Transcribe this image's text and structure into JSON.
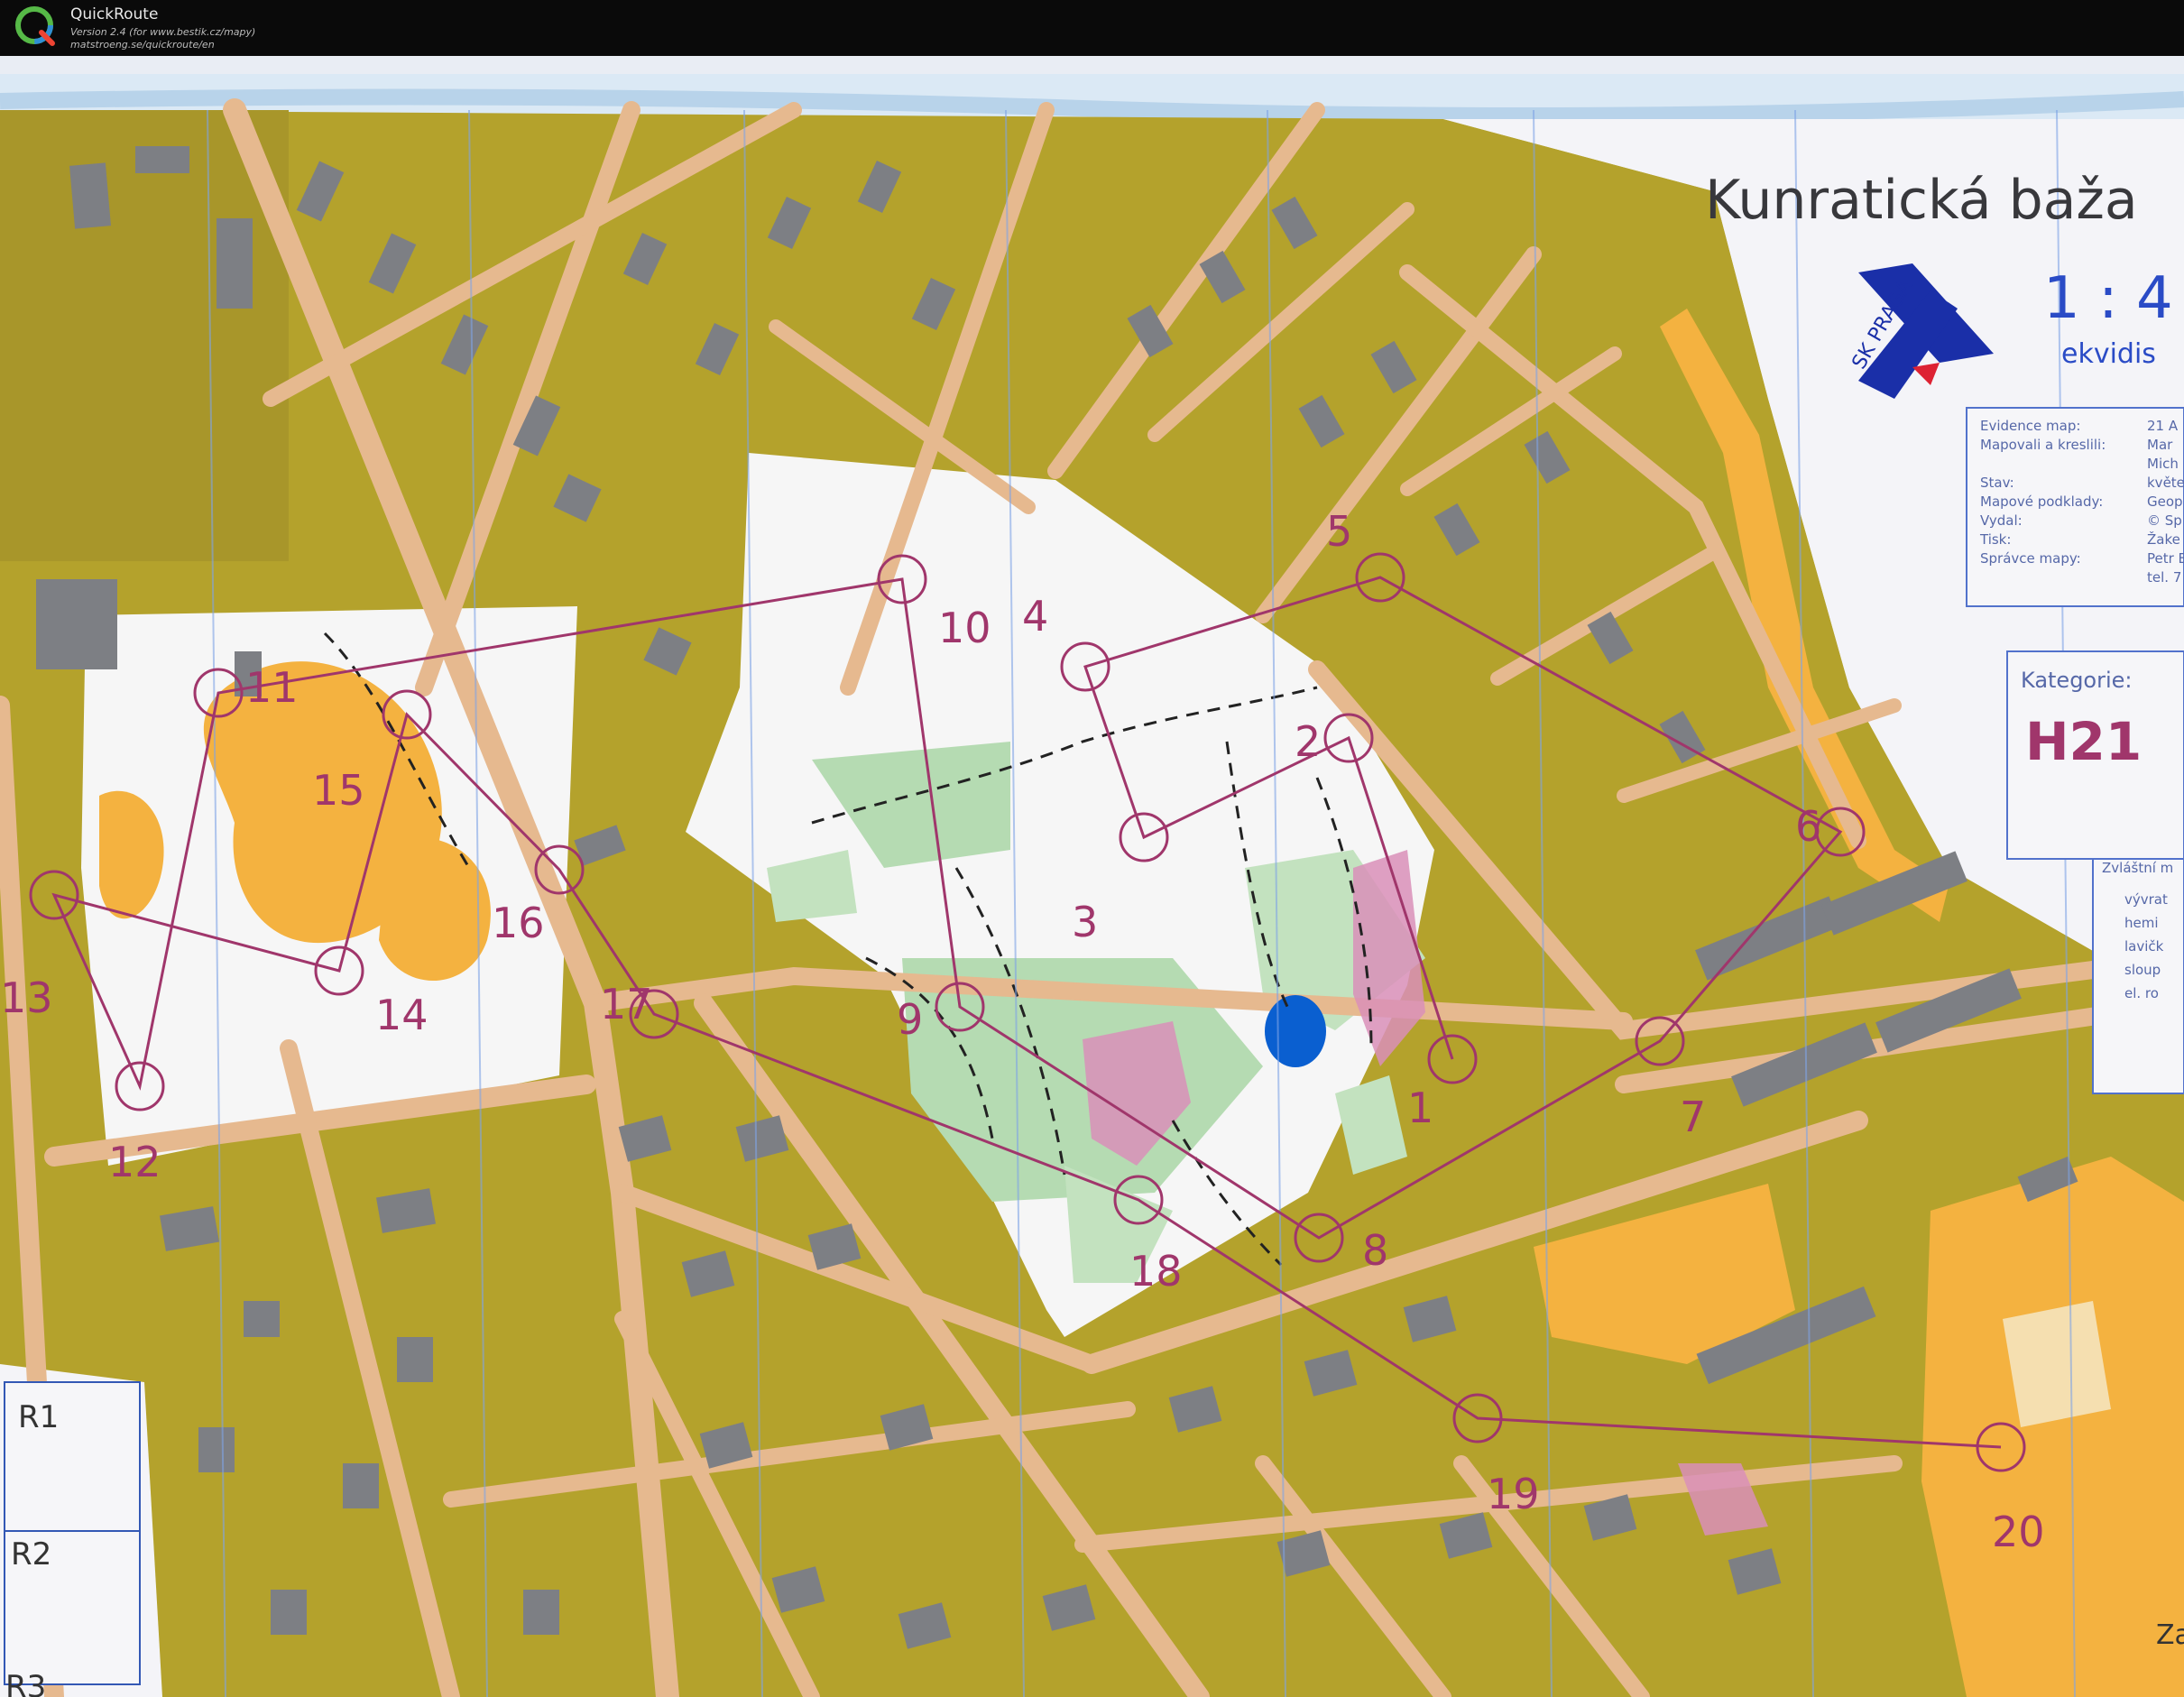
{
  "app": {
    "name": "QuickRoute",
    "version_line": "Version 2.4  (for www.bestik.cz/mapy)",
    "url_line": "matstroeng.se/quickroute/en"
  },
  "map": {
    "title": "Kunratická baža",
    "scale": "1 : 4",
    "ekvidistance": "ekvidis",
    "club_logo": "SK PRAGA",
    "info_labels": [
      "Evidence map:",
      "Mapovali a kreslili:",
      "",
      "Stav:",
      "Mapové podklady:",
      "Vydal:",
      "Tisk:",
      "Správce mapy:",
      ""
    ],
    "info_values": [
      "21 A",
      "Mar",
      "Mich",
      "květe",
      "Geop",
      "© Sp",
      "Žake",
      "Petr E",
      "tel. 7"
    ],
    "category_label": "Kategorie:",
    "category_value": "H21",
    "legend_title": "Zvláštní m",
    "legend_items": [
      "vývrat",
      "hemi",
      "lavičk",
      "sloup",
      "el. ro"
    ],
    "relay_labels": [
      "R1",
      "R2",
      "R3"
    ],
    "bottom_right_text": "Za",
    "colors": {
      "purple": "#a0366b",
      "olive": "#b4a22c",
      "orange": "#f4b240",
      "road": "#e6b98f",
      "green": "#b5dbb2",
      "water": "#0a5fd0"
    }
  },
  "controls": [
    {
      "label": "1"
    },
    {
      "label": "2"
    },
    {
      "label": "3"
    },
    {
      "label": "4"
    },
    {
      "label": "5"
    },
    {
      "label": "6"
    },
    {
      "label": "7"
    },
    {
      "label": "8"
    },
    {
      "label": "9"
    },
    {
      "label": "10"
    },
    {
      "label": "11"
    },
    {
      "label": "12"
    },
    {
      "label": "13"
    },
    {
      "label": "14"
    },
    {
      "label": "15"
    },
    {
      "label": "16"
    },
    {
      "label": "17"
    },
    {
      "label": "18"
    },
    {
      "label": "19"
    },
    {
      "label": "20"
    }
  ]
}
